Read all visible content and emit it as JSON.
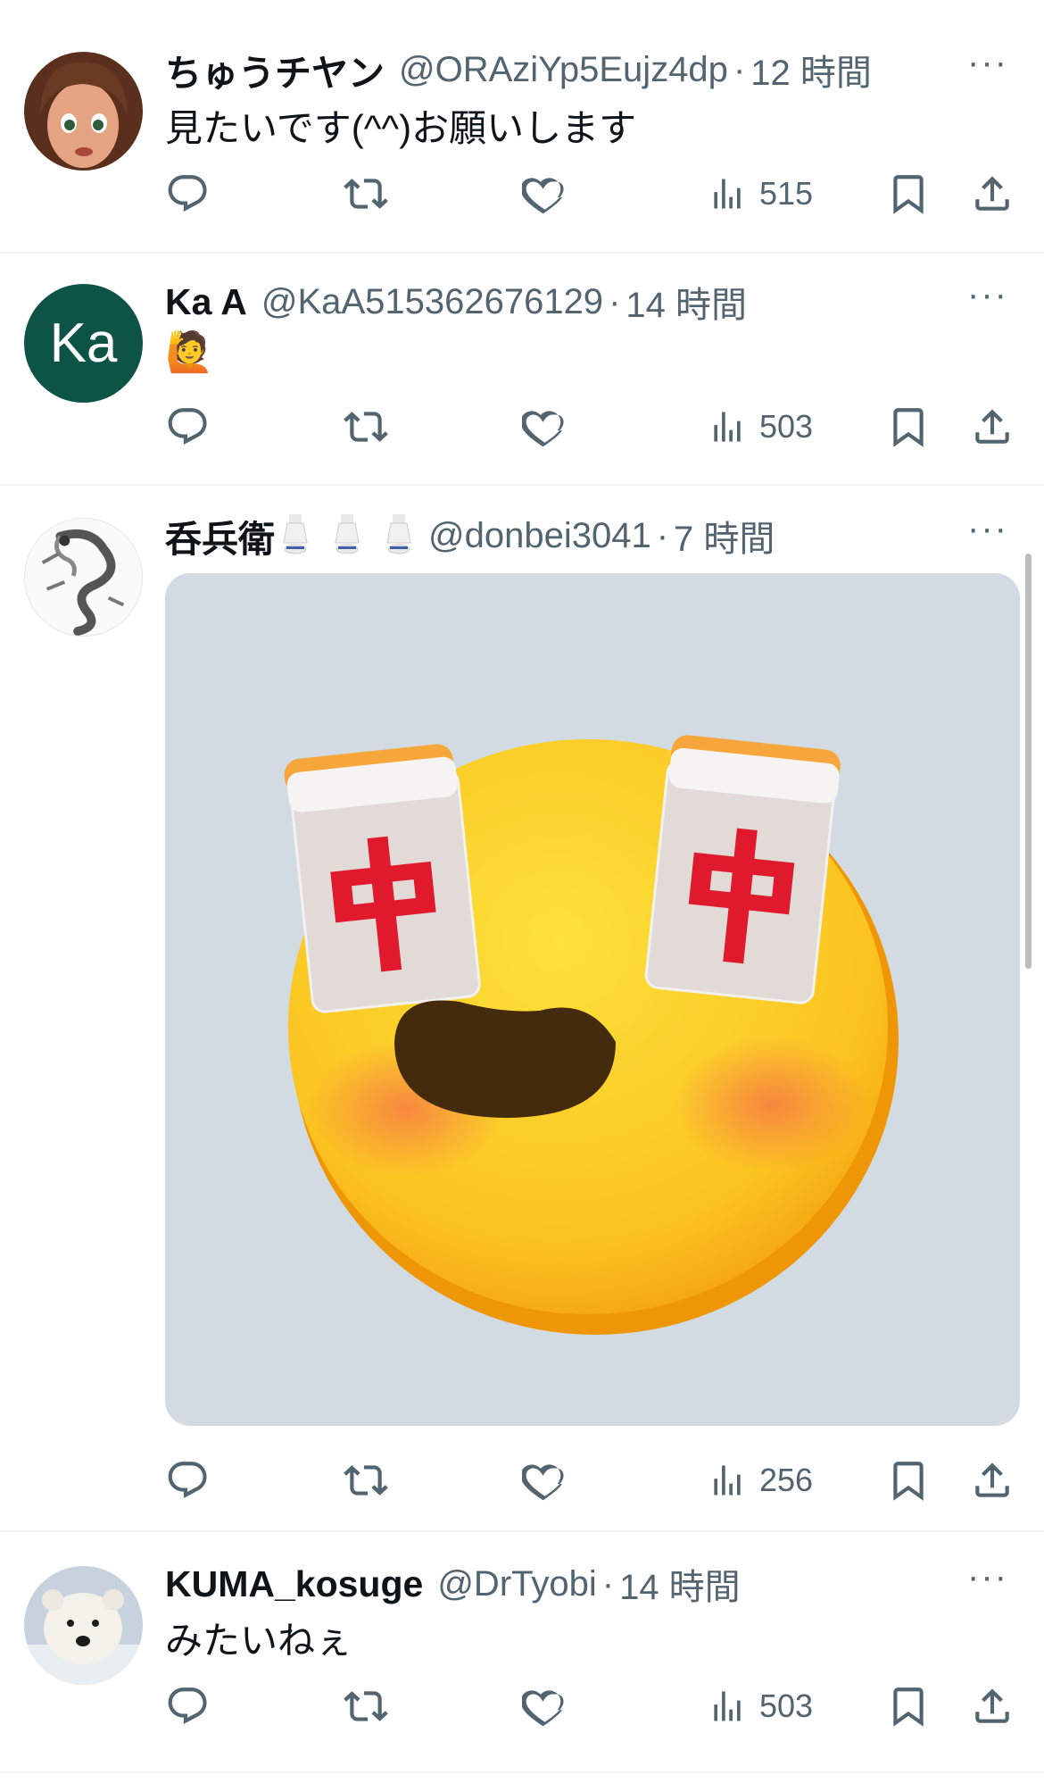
{
  "tweets": [
    {
      "name": "ちゅうチヤン",
      "handle": "@ORAziYp5Eujz4dp",
      "time": "12 時間",
      "text": "見たいです(^^)お願いします",
      "views": "515",
      "avatar": "cartoon-girl-avatar"
    },
    {
      "name": "Ka A",
      "handle": "@KaA515362676129",
      "time": "14 時間",
      "text": "🙋",
      "views": "503",
      "avatar_initials": "Ka",
      "avatar_color": "#0d5447"
    },
    {
      "name": "呑兵衛",
      "name_emoji": "sake-bottle-emoji x3",
      "handle": "@donbei3041",
      "time": "7 時間",
      "views": "256",
      "avatar": "dragon-avatar",
      "media": "mahjong-eyes-smiley-emoji",
      "tile_char": "中"
    },
    {
      "name": "KUMA_kosuge",
      "handle": "@DrTyobi",
      "time": "14 時間",
      "text": "みたいねぇ",
      "views": "503",
      "avatar": "polar-bear-avatar"
    }
  ],
  "more_label": "···",
  "dot": "·",
  "colors": {
    "secondary_text": "#536471",
    "divider": "#eff3f4",
    "media_bg": "#d1dbe1"
  }
}
